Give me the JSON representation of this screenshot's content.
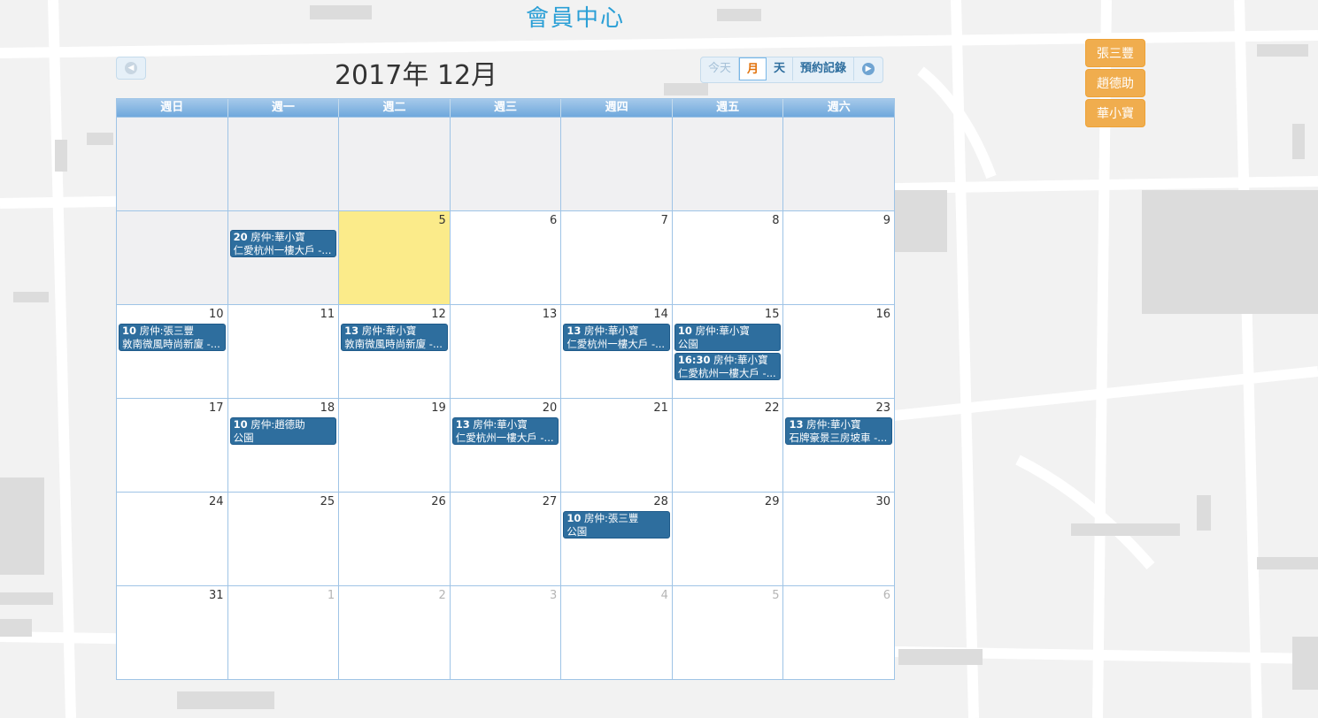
{
  "page_title": "會員中心",
  "calendar": {
    "month_title": "2017年 12月",
    "prev_icon": "chevron-left-icon",
    "next_icon": "chevron-right-icon",
    "view_buttons": {
      "today": "今天",
      "month": "月",
      "day": "天",
      "records": "預約記錄"
    },
    "weekdays": [
      "週日",
      "週一",
      "週二",
      "週三",
      "週四",
      "週五",
      "週六"
    ],
    "today_color": "#fbeb8a",
    "event_color": "#2e6e9e",
    "weeks": [
      [
        {
          "day": "",
          "other": true
        },
        {
          "day": "",
          "other": true
        },
        {
          "day": "",
          "other": true
        },
        {
          "day": "",
          "other": true
        },
        {
          "day": "",
          "other": true
        },
        {
          "day": "",
          "other": true
        },
        {
          "day": "",
          "other": true
        }
      ],
      [
        {
          "day": "",
          "other": true
        },
        {
          "day": "",
          "other": true,
          "events": [
            {
              "time": "20",
              "title": "房仲:華小寶",
              "desc": "仁愛杭州一樓大戶 -..."
            }
          ]
        },
        {
          "day": "5",
          "today": true
        },
        {
          "day": "6"
        },
        {
          "day": "7"
        },
        {
          "day": "8"
        },
        {
          "day": "9"
        }
      ],
      [
        {
          "day": "10",
          "events": [
            {
              "time": "10",
              "title": "房仲:張三豐",
              "desc": "敦南微風時尚新廈 -..."
            }
          ]
        },
        {
          "day": "11"
        },
        {
          "day": "12",
          "events": [
            {
              "time": "13",
              "title": "房仲:華小寶",
              "desc": "敦南微風時尚新廈 -..."
            }
          ]
        },
        {
          "day": "13"
        },
        {
          "day": "14",
          "events": [
            {
              "time": "13",
              "title": "房仲:華小寶",
              "desc": "仁愛杭州一樓大戶 -..."
            }
          ]
        },
        {
          "day": "15",
          "events": [
            {
              "time": "10",
              "title": "房仲:華小寶",
              "desc": "公園"
            },
            {
              "time": "16:30",
              "title": "房仲:華小寶",
              "desc": "仁愛杭州一樓大戶 -..."
            }
          ]
        },
        {
          "day": "16"
        }
      ],
      [
        {
          "day": "17"
        },
        {
          "day": "18",
          "events": [
            {
              "time": "10",
              "title": "房仲:趙德助",
              "desc": "公園"
            }
          ]
        },
        {
          "day": "19"
        },
        {
          "day": "20",
          "events": [
            {
              "time": "13",
              "title": "房仲:華小寶",
              "desc": "仁愛杭州一樓大戶 -..."
            }
          ]
        },
        {
          "day": "21"
        },
        {
          "day": "22"
        },
        {
          "day": "23",
          "events": [
            {
              "time": "13",
              "title": "房仲:華小寶",
              "desc": "石牌豪景三房坡車 -..."
            }
          ]
        }
      ],
      [
        {
          "day": "24"
        },
        {
          "day": "25"
        },
        {
          "day": "26"
        },
        {
          "day": "27"
        },
        {
          "day": "28",
          "events": [
            {
              "time": "10",
              "title": "房仲:張三豐",
              "desc": "公園"
            }
          ]
        },
        {
          "day": "29"
        },
        {
          "day": "30"
        }
      ],
      [
        {
          "day": "31"
        },
        {
          "day": "1",
          "faded": true
        },
        {
          "day": "2",
          "faded": true
        },
        {
          "day": "3",
          "faded": true
        },
        {
          "day": "4",
          "faded": true
        },
        {
          "day": "5",
          "faded": true
        },
        {
          "day": "6",
          "faded": true
        }
      ]
    ]
  },
  "members": [
    "張三豐",
    "趙德助",
    "華小寶"
  ],
  "member_button_color": "#f0ad4e"
}
